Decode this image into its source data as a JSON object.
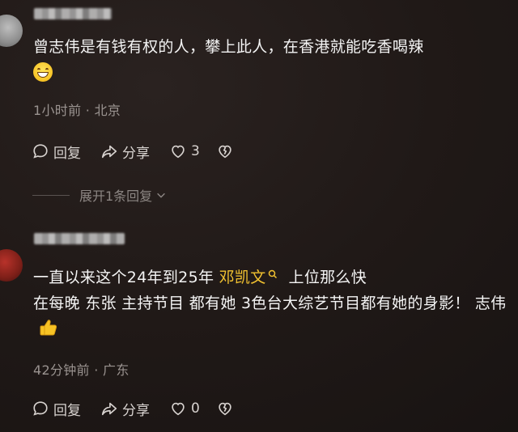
{
  "comments": [
    {
      "text_before_emoji": "曾志伟是有钱有权的人，攀上此人，在香港就能吃香喝辣",
      "emoji": "grinning-face",
      "time": "1小时前",
      "separator": "·",
      "location": "北京",
      "reply_label": "回复",
      "share_label": "分享",
      "likes": "3",
      "expand_label": "展开1条回复"
    },
    {
      "text_line1_start": "一直以来这个24年到25年",
      "mention": "邓凯文",
      "text_line1_end": "上位那么快",
      "text_line2": "在每晚 东张 主持节目 都有她 3色台大综艺节目都有她的身影！ 志伟",
      "emoji": "thumbs-up",
      "time": "42分钟前",
      "separator": "·",
      "location": "广东",
      "reply_label": "回复",
      "share_label": "分享",
      "likes": "0"
    }
  ],
  "colors": {
    "background": "#1c1614",
    "text": "#f4f4f4",
    "meta": "#9a9390",
    "mention": "#f2c230"
  }
}
